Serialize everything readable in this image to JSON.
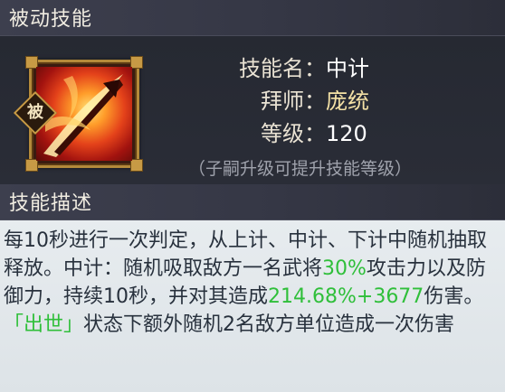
{
  "header1": {
    "title": "被动技能"
  },
  "skill": {
    "badge": "被",
    "name_label": "技能名",
    "name_value": "中计",
    "master_label": "拜师",
    "master_value": "庞统",
    "level_label": "等级",
    "level_value": "120",
    "hint": "（子嗣升级可提升技能等级）"
  },
  "header2": {
    "title": "技能描述"
  },
  "description": {
    "part1": "每10秒进行一次判定，从上计、中计、下计中随机抽取释放。中计：随机吸取敌方一名武将",
    "pct1": "30%",
    "part2": "攻击力以及防御力，持续10秒，并对其造成",
    "pct2": "214.68%+3677",
    "part3": "伤害。",
    "status": "「出世」",
    "part4": "状态下额外随机2名敌方单位造成一次伤害"
  },
  "colors": {
    "accent_green": "#2fbf3a",
    "frame_gold": "#b48a3a",
    "master_gold": "#f5e2a6"
  },
  "icons": {
    "skill_art": "flaming-sword-icon"
  }
}
